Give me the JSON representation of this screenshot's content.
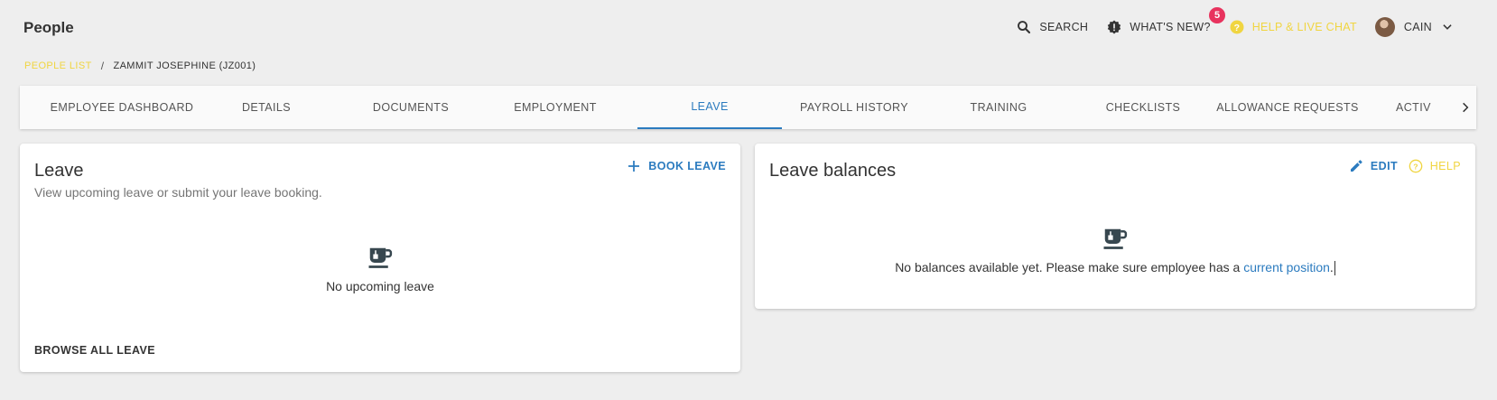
{
  "app": {
    "title": "People"
  },
  "topbar": {
    "search_label": "SEARCH",
    "whats_new_label": "WHAT'S NEW?",
    "whats_new_count": "5",
    "help_label": "HELP & LIVE CHAT",
    "user_name": "CAIN"
  },
  "breadcrumb": {
    "parent": "PEOPLE LIST",
    "separator": "/",
    "current": "ZAMMIT JOSEPHINE (JZ001)"
  },
  "tabs": [
    {
      "label": "EMPLOYEE DASHBOARD"
    },
    {
      "label": "DETAILS"
    },
    {
      "label": "DOCUMENTS"
    },
    {
      "label": "EMPLOYMENT"
    },
    {
      "label": "LEAVE",
      "active": true
    },
    {
      "label": "PAYROLL HISTORY"
    },
    {
      "label": "TRAINING"
    },
    {
      "label": "CHECKLISTS"
    },
    {
      "label": "ALLOWANCE REQUESTS"
    },
    {
      "label": "ACTIV"
    }
  ],
  "leave_card": {
    "title": "Leave",
    "subtitle": "View upcoming leave or submit your leave booking.",
    "book_label": "BOOK LEAVE",
    "empty_text": "No upcoming leave",
    "browse_label": "BROWSE ALL LEAVE"
  },
  "balances_card": {
    "title": "Leave balances",
    "edit_label": "EDIT",
    "help_label": "HELP",
    "empty_text": "No balances available yet. Please make sure employee has a ",
    "empty_link": "current position",
    "empty_suffix": "."
  },
  "colors": {
    "accent": "#2b7bbf",
    "help": "#f0d541",
    "badge": "#e8335e"
  },
  "icons": [
    "search-icon",
    "alert-icon",
    "help-circle-icon",
    "chevron-down-icon",
    "chevron-right-icon",
    "plus-icon",
    "pencil-icon",
    "coffee-cup-icon"
  ]
}
